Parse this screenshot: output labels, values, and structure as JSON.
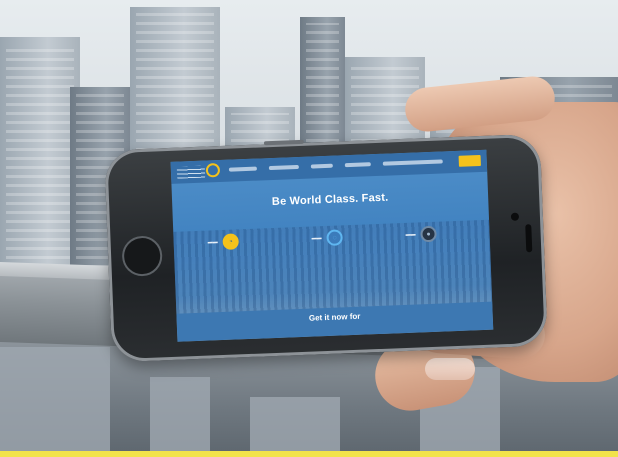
{
  "scene": {
    "description_icons": [
      "city-skyline",
      "railing",
      "hand",
      "smartphone"
    ]
  },
  "website": {
    "hero_title": "Be World Class. Fast.",
    "cta_text": "Get it now for",
    "nav_cta_color": "#f4c21b",
    "accent_color": "#3d7fbe"
  }
}
